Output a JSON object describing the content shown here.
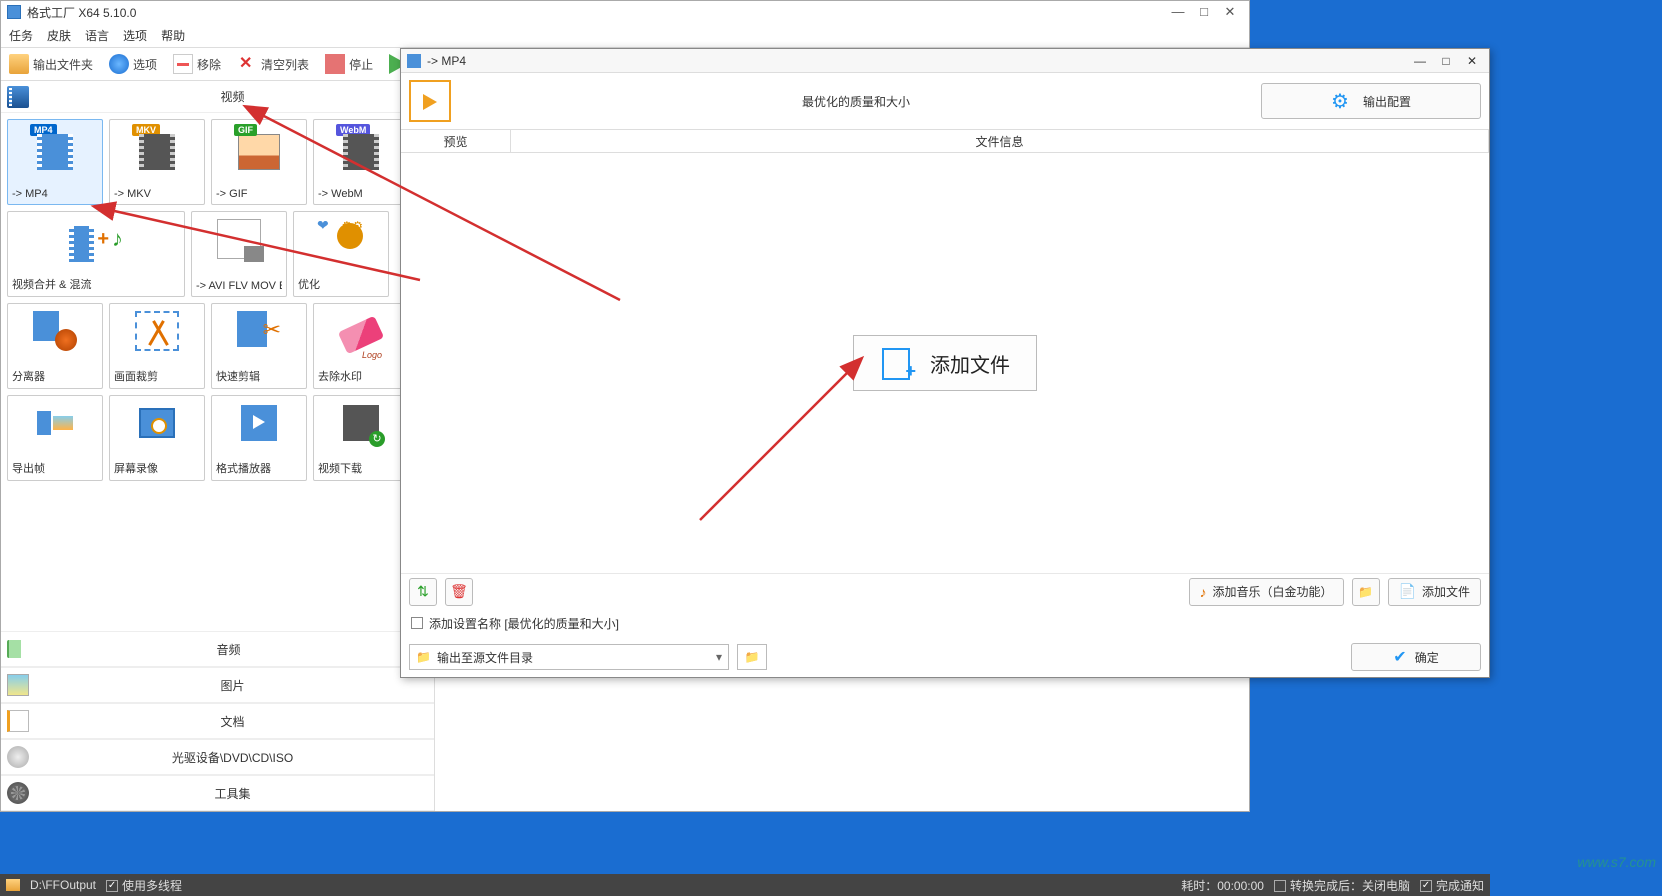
{
  "app": {
    "title": "格式工厂 X64 5.10.0"
  },
  "menu": {
    "task": "任务",
    "skin": "皮肤",
    "lang": "语言",
    "options": "选项",
    "help": "帮助"
  },
  "toolbar": {
    "outputFolder": "输出文件夹",
    "options": "选项",
    "remove": "移除",
    "clearList": "清空列表",
    "stop": "停止",
    "start": "开始"
  },
  "categories": {
    "video": "视频",
    "audio": "音频",
    "image": "图片",
    "document": "文档",
    "disc": "光驱设备\\DVD\\CD\\ISO",
    "tools": "工具集"
  },
  "tiles": {
    "mp4": "-> MP4",
    "mkv": "-> MKV",
    "gif": "-> GIF",
    "webm": "-> WebM",
    "merge": "视频合并 & 混流",
    "avi": "-> AVI FLV MOV Etc...",
    "optimize": "优化",
    "split": "分离器",
    "crop": "画面裁剪",
    "quickEdit": "快速剪辑",
    "watermark": "去除水印",
    "export": "导出帧",
    "record": "屏幕录像",
    "player": "格式播放器",
    "download": "视频下载"
  },
  "dialog": {
    "title": "-> MP4",
    "quality": "最优化的质量和大小",
    "outputConfig": "输出配置",
    "tabPreview": "预览",
    "tabInfo": "文件信息",
    "addFile": "添加文件",
    "addMusic": "添加音乐（白金功能）",
    "addFileBtn": "添加文件",
    "addSettingsName": "添加设置名称 [最优化的质量和大小]",
    "outputTo": "输出至源文件目录",
    "ok": "确定"
  },
  "status": {
    "path": "D:\\FFOutput",
    "multiThread": "使用多线程",
    "elapsed": "耗时：00:00:00",
    "afterDone": "转换完成后：关闭电脑",
    "doneNotify": "完成通知"
  }
}
